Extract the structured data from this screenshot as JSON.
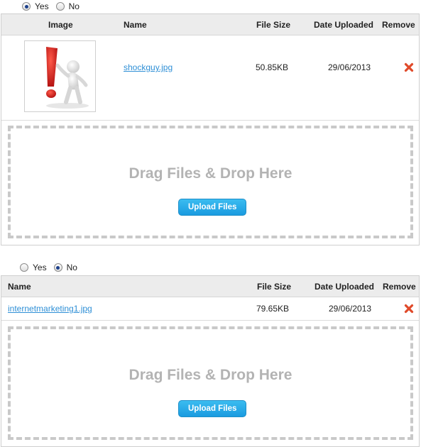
{
  "section1": {
    "radio_yes_label": "Yes",
    "radio_no_label": "No",
    "selected": "Yes",
    "headers": {
      "image": "Image",
      "name": "Name",
      "size": "File Size",
      "date": "Date Uploaded",
      "remove": "Remove"
    },
    "files": [
      {
        "name": "shockguy.jpg",
        "size": "50.85KB",
        "date": "29/06/2013",
        "thumbnail_icon": "exclamation-figure-image"
      }
    ],
    "dropzone_text": "Drag Files & Drop Here",
    "upload_label": "Upload Files"
  },
  "section2": {
    "radio_yes_label": "Yes",
    "radio_no_label": "No",
    "selected": "No",
    "headers": {
      "name": "Name",
      "size": "File Size",
      "date": "Date Uploaded",
      "remove": "Remove"
    },
    "files": [
      {
        "name": "internetmarketing1.jpg",
        "size": "79.65KB",
        "date": "29/06/2013"
      }
    ],
    "dropzone_text": "Drag Files & Drop Here",
    "upload_label": "Upload Files"
  },
  "colors": {
    "link": "#2e8fd6",
    "remove_icon": "#e04a2a",
    "button": "#1a9be0",
    "drop_border": "#c9c9c9"
  }
}
